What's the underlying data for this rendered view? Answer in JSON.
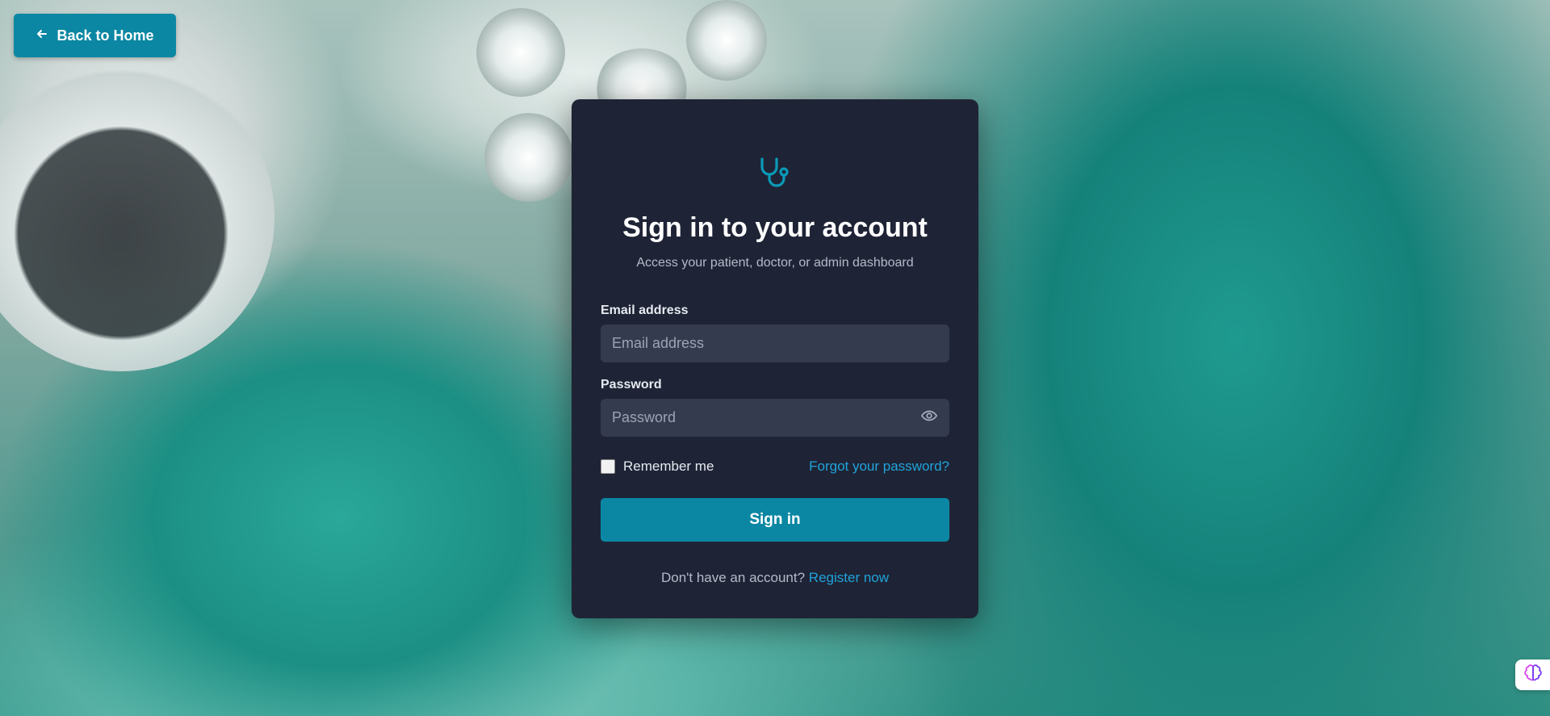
{
  "header": {
    "back_label": "Back to Home"
  },
  "login": {
    "title": "Sign in to your account",
    "subtitle": "Access your patient, doctor, or admin dashboard",
    "email_label": "Email address",
    "email_placeholder": "Email address",
    "email_value": "",
    "password_label": "Password",
    "password_placeholder": "Password",
    "password_value": "",
    "remember_label": "Remember me",
    "remember_checked": false,
    "forgot_label": "Forgot your password?",
    "signin_label": "Sign in",
    "register_prompt": "Don't have an account?",
    "register_link": "Register now"
  },
  "icons": {
    "logo": "stethoscope-icon",
    "back": "arrow-left-icon",
    "password_toggle": "eye-icon",
    "helper": "brain-icon"
  },
  "colors": {
    "accent": "#0b87a3",
    "link": "#21a3db",
    "card_bg": "#1e2435",
    "input_bg": "#353b4e"
  }
}
